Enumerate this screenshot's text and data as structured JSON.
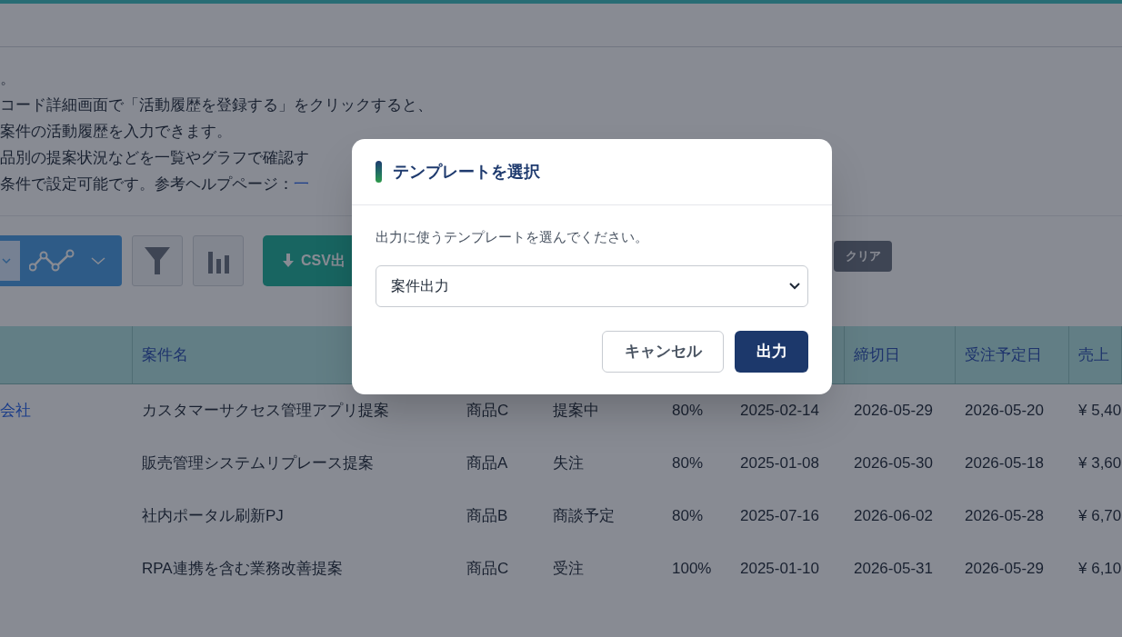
{
  "notes": [
    "。",
    "コード詳細画面で「活動履歴を登録する」をクリックすると、",
    "案件の活動履歴を入力できます。",
    "品別の提案状況などを一覧やグラフで確認す",
    "条件で設定可能です。参考ヘルプページ："
  ],
  "help_link": "一",
  "toolbar": {
    "csv_button": "CSV出",
    "clear_button": "クリア"
  },
  "table": {
    "columns": [
      null,
      "案件名",
      null,
      null,
      null,
      null,
      "締切日",
      "受注予定日",
      "売上"
    ],
    "rows": [
      {
        "cells": [
          "会社",
          "カスタマーサクセス管理アプリ提案",
          "商品C",
          "提案中",
          "80%",
          "2025-02-14",
          "2026-05-29",
          "2026-05-20",
          "¥ 5,40"
        ]
      },
      {
        "cells": [
          null,
          "販売管理システムリプレース提案",
          "商品A",
          "失注",
          "80%",
          "2025-01-08",
          "2026-05-30",
          "2026-05-18",
          "¥ 3,60"
        ]
      },
      {
        "cells": [
          null,
          "社内ポータル刷新PJ",
          "商品B",
          "商談予定",
          "80%",
          "2025-07-16",
          "2026-06-02",
          "2026-05-28",
          "¥ 6,70"
        ]
      },
      {
        "cells": [
          null,
          "RPA連携を含む業務改善提案",
          "商品C",
          "受注",
          "100%",
          "2025-01-10",
          "2026-05-31",
          "2026-05-29",
          "¥ 6,10"
        ]
      }
    ]
  },
  "dialog": {
    "title": "テンプレートを選択",
    "message": "出力に使うテンプレートを選んでください。",
    "select_value": "案件出力",
    "cancel_button": "キャンセル",
    "ok_button": "出力"
  }
}
